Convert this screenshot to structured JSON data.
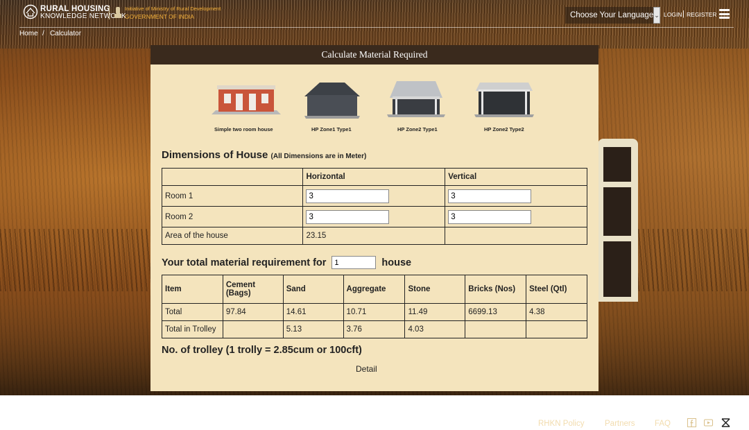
{
  "header": {
    "logo_line1": "RURAL HOUSING",
    "logo_line2": "KNOWLEDGE NETWORK",
    "gov_line1": "Initiative of Ministry of Rural Development",
    "gov_line2": "GOVERNMENT OF INDIA",
    "language_select": "Choose Your Language",
    "login": "LOGIN",
    "separator": "|",
    "register": "REGISTER"
  },
  "breadcrumb": {
    "home": "Home",
    "separator": "/",
    "current": "Calculator"
  },
  "panel": {
    "title": "Calculate Material Required",
    "house_types": [
      {
        "label": "Simple two room house"
      },
      {
        "label": "HP Zone1 Type1"
      },
      {
        "label": "HP Zone2 Type1"
      },
      {
        "label": "HP Zone2 Type2"
      }
    ],
    "dimensions": {
      "title": "Dimensions of House",
      "note": "(All Dimensions are in Meter)",
      "col_horizontal": "Horizontal",
      "col_vertical": "Vertical",
      "rows": [
        {
          "label": "Room 1",
          "horizontal": "3",
          "vertical": "3"
        },
        {
          "label": "Room 2",
          "horizontal": "3",
          "vertical": "3"
        }
      ],
      "area_label": "Area of the house",
      "area_value": "23.15"
    },
    "requirement": {
      "prefix": "Your total material requirement for",
      "count": "1",
      "suffix": "house"
    },
    "materials": {
      "headers": [
        "Item",
        "Cement (Bags)",
        "Sand",
        "Aggregate",
        "Stone",
        "Bricks (Nos)",
        "Steel (Qtl)"
      ],
      "rows": [
        [
          "Total",
          "97.84",
          "14.61",
          "10.71",
          "11.49",
          "6699.13",
          "4.38"
        ],
        [
          "Total in Trolley",
          "",
          "5.13",
          "3.76",
          "4.03",
          "",
          ""
        ]
      ]
    },
    "trolley_note": "No. of trolley (1 trolly = 2.85cum or 100cft)",
    "detail_link": "Detail"
  },
  "footer": {
    "links": [
      "RHKN Policy",
      "Partners",
      "FAQ"
    ],
    "icons": [
      "facebook-icon",
      "youtube-icon",
      "close-icon"
    ]
  }
}
